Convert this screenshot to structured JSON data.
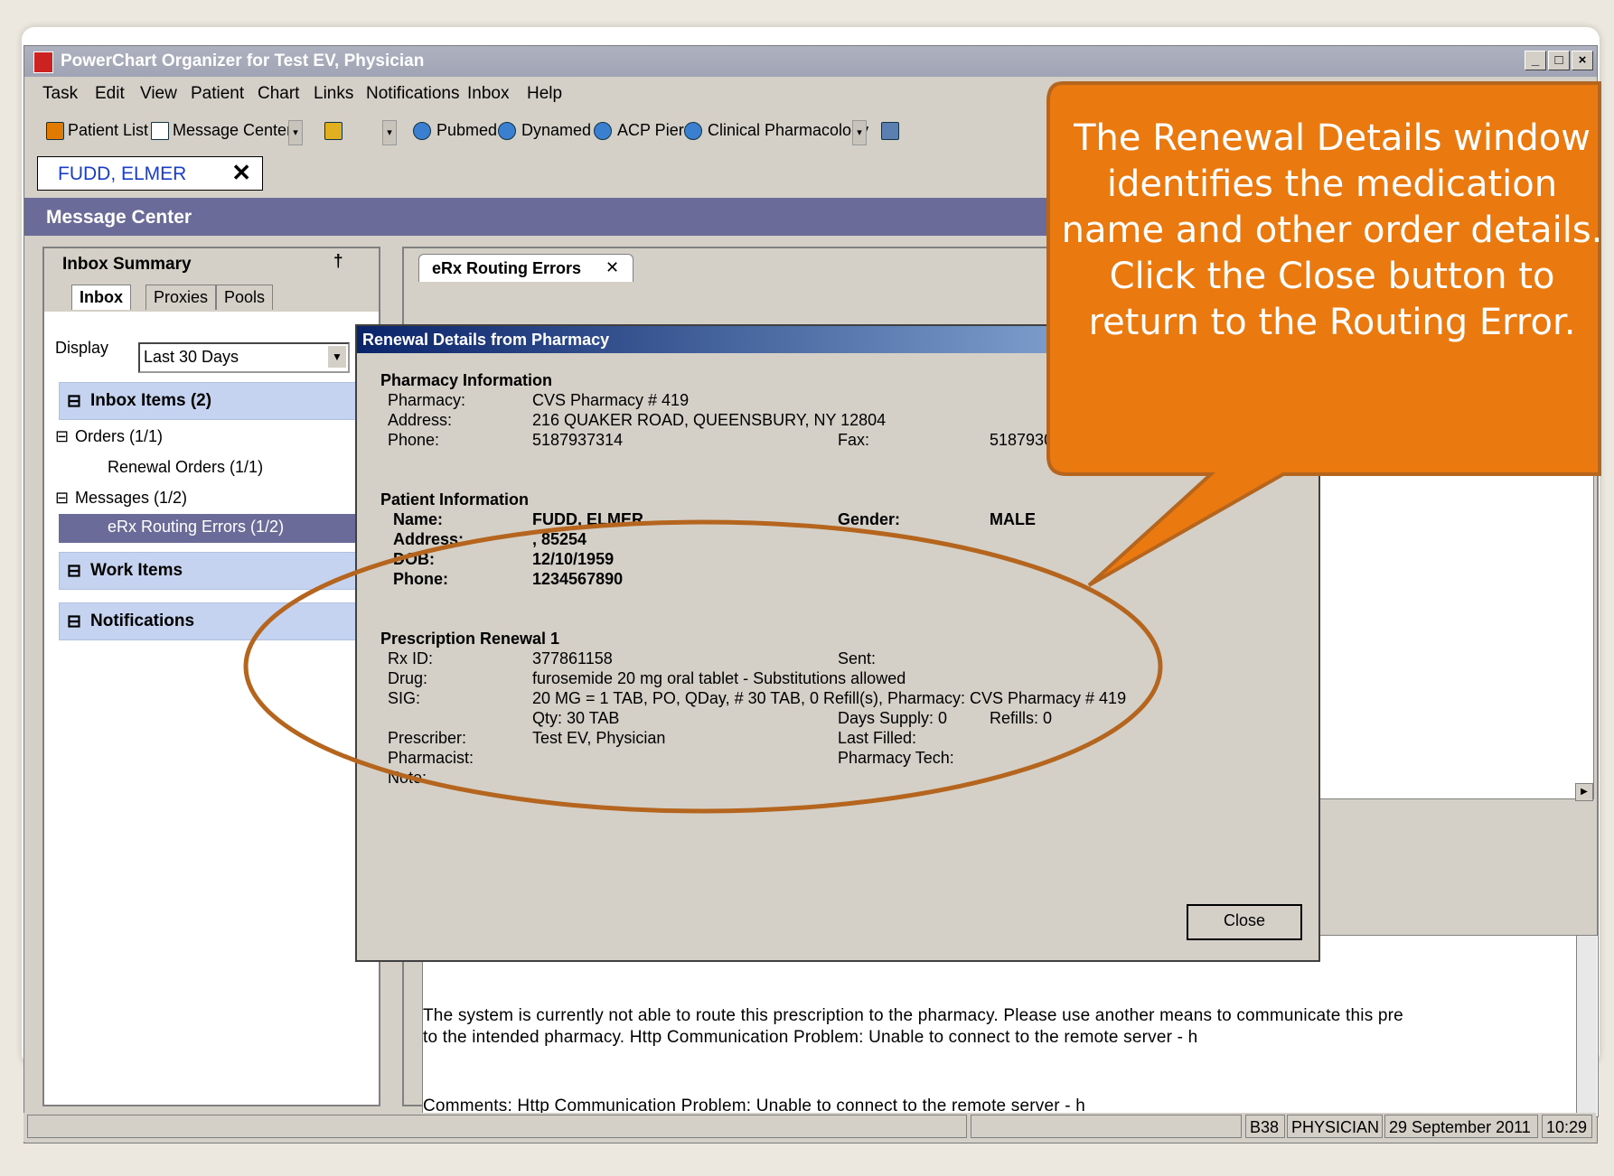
{
  "window": {
    "title": "PowerChart Organizer for Test EV, Physician",
    "controls": [
      "_",
      "□",
      "×"
    ]
  },
  "menu": [
    "Task",
    "Edit",
    "View",
    "Patient",
    "Chart",
    "Links",
    "Notifications",
    "Inbox",
    "Help"
  ],
  "toolbar": {
    "patient_list": "Patient List",
    "message_center": "Message Center",
    "pubmed": "Pubmed",
    "dynamed": "Dynamed",
    "acp_pier": "ACP Pier",
    "clinical_pharmacology": "Clinical Pharmacology"
  },
  "patient_tab": {
    "name": "FUDD, ELMER",
    "close": "✕"
  },
  "message_center_title": "Message Center",
  "inbox_summary": {
    "title": "Inbox Summary",
    "pin": "†",
    "tabs": [
      "Inbox",
      "Proxies",
      "Pools"
    ],
    "display_label": "Display",
    "display_value": "Last 30 Days",
    "inbox_items": "Inbox Items (2)",
    "orders": "Orders (1/1)",
    "renewal_orders": "Renewal Orders (1/1)",
    "messages": "Messages (1/2)",
    "erx_routing": "eRx Routing Errors (1/2)",
    "work_items": "Work Items",
    "notifications": "Notifications",
    "collapse": "⊟"
  },
  "right_tab": {
    "label": "eRx Routing Errors",
    "close": "✕"
  },
  "message_body": {
    "line1": "The system is currently not able to route this prescription to the pharmacy.  Please use another means to communicate this pre",
    "line2": "to the intended pharmacy. Http Communication Problem: Unable to connect to the remote server - h",
    "line3": "Comments: Http Communication Problem: Unable to connect to the remote server - h"
  },
  "dialog": {
    "title": "Renewal Details from Pharmacy",
    "pharmacy_header": "Pharmacy Information",
    "pharmacy_label": "Pharmacy:",
    "pharmacy_value": "CVS Pharmacy # 419",
    "address_label": "Address:",
    "address_value": "216 QUAKER ROAD, QUEENSBURY, NY 12804",
    "phone_label": "Phone:",
    "phone_value": "5187937314",
    "fax_label": "Fax:",
    "fax_value": "5187930",
    "patient_header": "Patient Information",
    "name_label": "Name:",
    "name_value": "FUDD, ELMER",
    "gender_label": "Gender:",
    "gender_value": "MALE",
    "p_address_label": "Address:",
    "p_address_value": ",   85254",
    "dob_label": "DOB:",
    "dob_value": "12/10/1959",
    "p_phone_label": "Phone:",
    "p_phone_value": "1234567890",
    "rx_header": "Prescription Renewal 1",
    "rxid_label": "Rx ID:",
    "rxid_value": "377861158",
    "sent_label": "Sent:",
    "drug_label": "Drug:",
    "drug_value": "furosemide 20 mg oral tablet - Substitutions allowed",
    "sig_label": "SIG:",
    "sig_value": "20 MG = 1 TAB, PO, QDay, # 30 TAB, 0 Refill(s), Pharmacy: CVS Pharmacy # 419",
    "qty_value": "Qty: 30 TAB",
    "days_supply": "Days Supply: 0",
    "refills": "Refills: 0",
    "prescriber_label": "Prescriber:",
    "prescriber_value": "Test EV, Physician",
    "last_filled": "Last Filled:",
    "pharmacist_label": "Pharmacist:",
    "pharmacy_tech": "Pharmacy Tech:",
    "note_label": "Note:",
    "close_button": "Close"
  },
  "statusbar": {
    "location": "B38",
    "role": "PHYSICIAN",
    "date": "29 September 2011",
    "time": "10:29"
  },
  "callout": {
    "text": "The Renewal Details window identifies the medication name and other order details.  Click the Close button to return to the Routing Error.",
    "color": "#ea7a10"
  }
}
